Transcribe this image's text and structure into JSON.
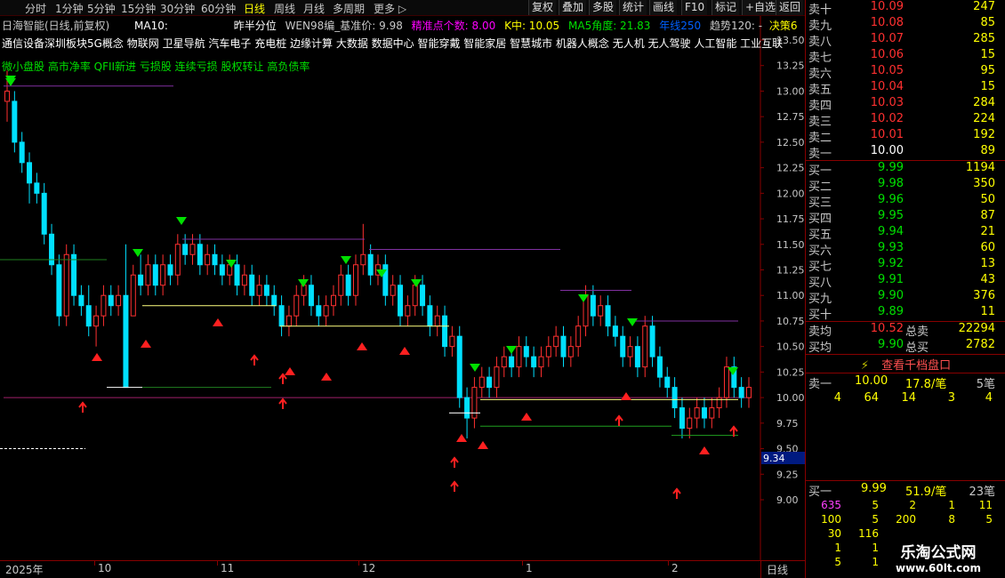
{
  "toolbar": {
    "periods": [
      "分时",
      "1分钟",
      "5分钟",
      "15分钟",
      "30分钟",
      "60分钟",
      "日线",
      "周线",
      "月线",
      "多周期",
      "更多"
    ],
    "active_period": "日线",
    "buttons": [
      "复权",
      "叠加",
      "多股",
      "统计",
      "画线",
      "F10",
      "标记",
      "+自选",
      "返回"
    ]
  },
  "stock": {
    "title": "日海智能(日线,前复权)",
    "ma_label": "MA10:",
    "indicator_name": "昨半分位",
    "indicator_text": "WEN98编_基准价: 9.98",
    "precise_label": "精准点个数: 8.00",
    "k_label": "K中: 10.05",
    "ma5_label": "MA5角度: 21.83",
    "year_line": "年线250",
    "trend_label": "趋势120: -",
    "decision_label": "决策6"
  },
  "concepts": "通信设备深圳板块5G概念 物联网 卫星导航 汽车电子 充电桩 边缘计算 大数据 数据中心 智能穿戴 智能家居 智慧城市 机器人概念 无人机 无人驾驶 人工智能 工业互联",
  "tags": "微小盘股 高市净率 QFII新进 亏损股 连续亏损 股权转让 高负债率",
  "price_axis": [
    "13.50",
    "13.25",
    "13.00",
    "12.75",
    "12.50",
    "12.25",
    "12.00",
    "11.75",
    "11.50",
    "11.25",
    "11.00",
    "10.75",
    "10.50",
    "10.25",
    "10.00",
    "9.75",
    "9.50",
    "9.25",
    "9.00"
  ],
  "current_price_label": "9.34",
  "date_axis": [
    "2025年",
    "10",
    "11",
    "12",
    "1",
    "2"
  ],
  "period_label": "日线",
  "order_book": {
    "asks": [
      {
        "label": "卖十",
        "price": "10.09",
        "vol": "247"
      },
      {
        "label": "卖九",
        "price": "10.08",
        "vol": "85"
      },
      {
        "label": "卖八",
        "price": "10.07",
        "vol": "285"
      },
      {
        "label": "卖七",
        "price": "10.06",
        "vol": "15"
      },
      {
        "label": "卖六",
        "price": "10.05",
        "vol": "95"
      },
      {
        "label": "卖五",
        "price": "10.04",
        "vol": "15"
      },
      {
        "label": "卖四",
        "price": "10.03",
        "vol": "284"
      },
      {
        "label": "卖三",
        "price": "10.02",
        "vol": "224"
      },
      {
        "label": "卖二",
        "price": "10.01",
        "vol": "192"
      },
      {
        "label": "卖一",
        "price": "10.00",
        "vol": "89"
      }
    ],
    "bids": [
      {
        "label": "买一",
        "price": "9.99",
        "vol": "1194"
      },
      {
        "label": "买二",
        "price": "9.98",
        "vol": "350"
      },
      {
        "label": "买三",
        "price": "9.96",
        "vol": "50"
      },
      {
        "label": "买四",
        "price": "9.95",
        "vol": "87"
      },
      {
        "label": "买五",
        "price": "9.94",
        "vol": "21"
      },
      {
        "label": "买六",
        "price": "9.93",
        "vol": "60"
      },
      {
        "label": "买七",
        "price": "9.92",
        "vol": "13"
      },
      {
        "label": "买八",
        "price": "9.91",
        "vol": "43"
      },
      {
        "label": "买九",
        "price": "9.90",
        "vol": "376"
      },
      {
        "label": "买十",
        "price": "9.89",
        "vol": "11"
      }
    ],
    "avg_sell_label": "卖均",
    "avg_sell": "10.52",
    "total_sell_label": "总卖",
    "total_sell": "22294",
    "avg_buy_label": "买均",
    "avg_buy": "9.90",
    "total_buy_label": "总买",
    "total_buy": "2782",
    "thousand_link": "查看千档盘口"
  },
  "queue_sell": {
    "label": "卖一",
    "price": "10.00",
    "qty": "17.8/笔",
    "count": "5笔",
    "orders": [
      "4",
      "64",
      "14",
      "3",
      "4"
    ]
  },
  "queue_buy": {
    "label": "买一",
    "price": "9.99",
    "qty": "51.9/笔",
    "count": "23笔",
    "rows": [
      [
        "635",
        "5",
        "2",
        "1",
        "11"
      ],
      [
        "100",
        "5",
        "200",
        "8",
        "5"
      ],
      [
        "30",
        "116",
        "",
        "",
        ""
      ],
      [
        "1",
        "1",
        "",
        "",
        ""
      ],
      [
        "5",
        "1",
        "",
        "",
        ""
      ]
    ]
  },
  "watermark": {
    "line1": "乐淘公式网",
    "line2": "www.60lt.com"
  },
  "chart_data": {
    "type": "candlestick",
    "title": "日海智能(日线,前复权)",
    "ylim": [
      9.0,
      13.6
    ],
    "y_ticks": [
      13.5,
      13.25,
      13.0,
      12.75,
      12.5,
      12.25,
      12.0,
      11.75,
      11.5,
      11.25,
      11.0,
      10.75,
      10.5,
      10.25,
      10.0,
      9.75,
      9.5,
      9.25,
      9.0
    ],
    "x_labels": [
      "2025年",
      "10",
      "11",
      "12",
      "1",
      "2"
    ],
    "candles": [
      [
        12.9,
        13.0,
        13.2,
        12.7
      ],
      [
        12.9,
        12.5,
        13.0,
        12.4
      ],
      [
        12.5,
        12.3,
        12.6,
        12.2
      ],
      [
        12.3,
        12.1,
        12.4,
        11.9
      ],
      [
        12.1,
        12.0,
        12.2,
        11.9
      ],
      [
        12.0,
        11.6,
        12.1,
        11.5
      ],
      [
        11.6,
        11.3,
        11.7,
        11.2
      ],
      [
        11.3,
        10.8,
        11.4,
        10.7
      ],
      [
        10.8,
        11.4,
        11.5,
        10.7
      ],
      [
        11.4,
        11.0,
        11.5,
        10.9
      ],
      [
        11.0,
        10.9,
        11.1,
        10.8
      ],
      [
        10.9,
        10.7,
        11.1,
        10.6
      ],
      [
        10.7,
        10.8,
        10.9,
        10.5
      ],
      [
        10.8,
        11.0,
        11.1,
        10.7
      ],
      [
        11.0,
        10.9,
        11.1,
        10.8
      ],
      [
        10.9,
        11.0,
        11.1,
        10.8
      ],
      [
        11.0,
        10.1,
        11.5,
        10.1
      ],
      [
        10.8,
        11.2,
        11.3,
        10.8
      ],
      [
        11.2,
        11.1,
        11.4,
        11.0
      ],
      [
        11.1,
        11.3,
        11.4,
        11.0
      ],
      [
        11.3,
        11.1,
        11.4,
        11.0
      ],
      [
        11.1,
        11.3,
        11.4,
        11.0
      ],
      [
        11.3,
        11.2,
        11.4,
        11.1
      ],
      [
        11.2,
        11.5,
        11.6,
        11.1
      ],
      [
        11.5,
        11.4,
        11.6,
        11.3
      ],
      [
        11.4,
        11.5,
        11.6,
        11.3
      ],
      [
        11.5,
        11.3,
        11.6,
        11.2
      ],
      [
        11.3,
        11.4,
        11.5,
        11.2
      ],
      [
        11.4,
        11.3,
        11.5,
        11.2
      ],
      [
        11.3,
        11.2,
        11.4,
        11.1
      ],
      [
        11.2,
        11.3,
        11.4,
        11.1
      ],
      [
        11.3,
        11.1,
        11.4,
        11.0
      ],
      [
        11.1,
        11.2,
        11.3,
        11.0
      ],
      [
        11.2,
        11.0,
        11.3,
        10.9
      ],
      [
        11.0,
        11.1,
        11.2,
        10.9
      ],
      [
        11.1,
        11.0,
        11.2,
        10.9
      ],
      [
        11.0,
        10.9,
        11.1,
        10.8
      ],
      [
        10.9,
        10.7,
        11.0,
        10.6
      ],
      [
        10.7,
        10.8,
        10.9,
        10.6
      ],
      [
        10.8,
        11.0,
        11.1,
        10.7
      ],
      [
        11.0,
        11.1,
        11.2,
        10.9
      ],
      [
        11.1,
        10.9,
        11.2,
        10.8
      ],
      [
        10.9,
        10.8,
        11.0,
        10.7
      ],
      [
        10.8,
        10.9,
        11.0,
        10.7
      ],
      [
        10.9,
        11.0,
        11.1,
        10.8
      ],
      [
        11.0,
        11.2,
        11.3,
        10.9
      ],
      [
        11.2,
        11.0,
        11.3,
        10.9
      ],
      [
        11.0,
        11.3,
        11.4,
        10.9
      ],
      [
        11.3,
        11.4,
        11.7,
        11.2
      ],
      [
        11.4,
        11.2,
        11.5,
        11.1
      ],
      [
        11.2,
        11.3,
        11.4,
        11.1
      ],
      [
        11.3,
        11.0,
        11.4,
        10.9
      ],
      [
        11.0,
        11.1,
        11.2,
        10.9
      ],
      [
        11.1,
        10.8,
        11.2,
        10.7
      ],
      [
        10.8,
        10.9,
        11.0,
        10.7
      ],
      [
        10.9,
        11.1,
        11.2,
        10.8
      ],
      [
        11.1,
        10.9,
        11.2,
        10.8
      ],
      [
        10.9,
        10.7,
        11.0,
        10.6
      ],
      [
        10.7,
        10.8,
        10.9,
        10.6
      ],
      [
        10.8,
        10.5,
        10.9,
        10.4
      ],
      [
        10.5,
        10.6,
        10.7,
        10.4
      ],
      [
        10.6,
        10.0,
        10.7,
        9.9
      ],
      [
        10.0,
        9.8,
        10.1,
        9.6
      ],
      [
        9.8,
        10.1,
        10.2,
        9.7
      ],
      [
        10.1,
        10.2,
        10.3,
        10.0
      ],
      [
        10.2,
        10.1,
        10.3,
        10.0
      ],
      [
        10.1,
        10.3,
        10.4,
        10.0
      ],
      [
        10.3,
        10.4,
        10.5,
        10.2
      ],
      [
        10.4,
        10.3,
        10.5,
        10.2
      ],
      [
        10.3,
        10.5,
        10.6,
        10.2
      ],
      [
        10.5,
        10.4,
        10.6,
        10.3
      ],
      [
        10.4,
        10.3,
        10.5,
        10.2
      ],
      [
        10.3,
        10.4,
        10.5,
        10.2
      ],
      [
        10.4,
        10.5,
        10.6,
        10.3
      ],
      [
        10.5,
        10.6,
        10.7,
        10.4
      ],
      [
        10.6,
        10.4,
        10.7,
        10.3
      ],
      [
        10.4,
        10.5,
        10.6,
        10.3
      ],
      [
        10.5,
        10.7,
        10.8,
        10.4
      ],
      [
        10.7,
        11.0,
        11.1,
        10.6
      ],
      [
        11.0,
        10.8,
        11.1,
        10.7
      ],
      [
        10.8,
        10.9,
        11.0,
        10.7
      ],
      [
        10.9,
        10.7,
        11.0,
        10.6
      ],
      [
        10.7,
        10.6,
        10.8,
        10.5
      ],
      [
        10.6,
        10.4,
        10.7,
        10.3
      ],
      [
        10.4,
        10.5,
        10.6,
        10.3
      ],
      [
        10.5,
        10.3,
        10.6,
        10.2
      ],
      [
        10.3,
        10.7,
        10.8,
        10.2
      ],
      [
        10.7,
        10.4,
        10.8,
        10.3
      ],
      [
        10.4,
        10.2,
        10.5,
        10.1
      ],
      [
        10.2,
        10.1,
        10.3,
        10.0
      ],
      [
        10.1,
        9.9,
        10.2,
        9.8
      ],
      [
        9.9,
        9.7,
        10.0,
        9.6
      ],
      [
        9.7,
        9.8,
        9.9,
        9.6
      ],
      [
        9.8,
        9.9,
        10.0,
        9.7
      ],
      [
        9.9,
        9.8,
        10.0,
        9.7
      ],
      [
        9.8,
        9.9,
        10.0,
        9.7
      ],
      [
        9.9,
        10.0,
        10.1,
        9.8
      ],
      [
        10.0,
        10.3,
        10.4,
        9.9
      ],
      [
        10.3,
        10.1,
        10.4,
        10.0
      ],
      [
        10.1,
        10.0,
        10.2,
        9.9
      ],
      [
        10.0,
        10.1,
        10.2,
        9.9
      ]
    ]
  }
}
